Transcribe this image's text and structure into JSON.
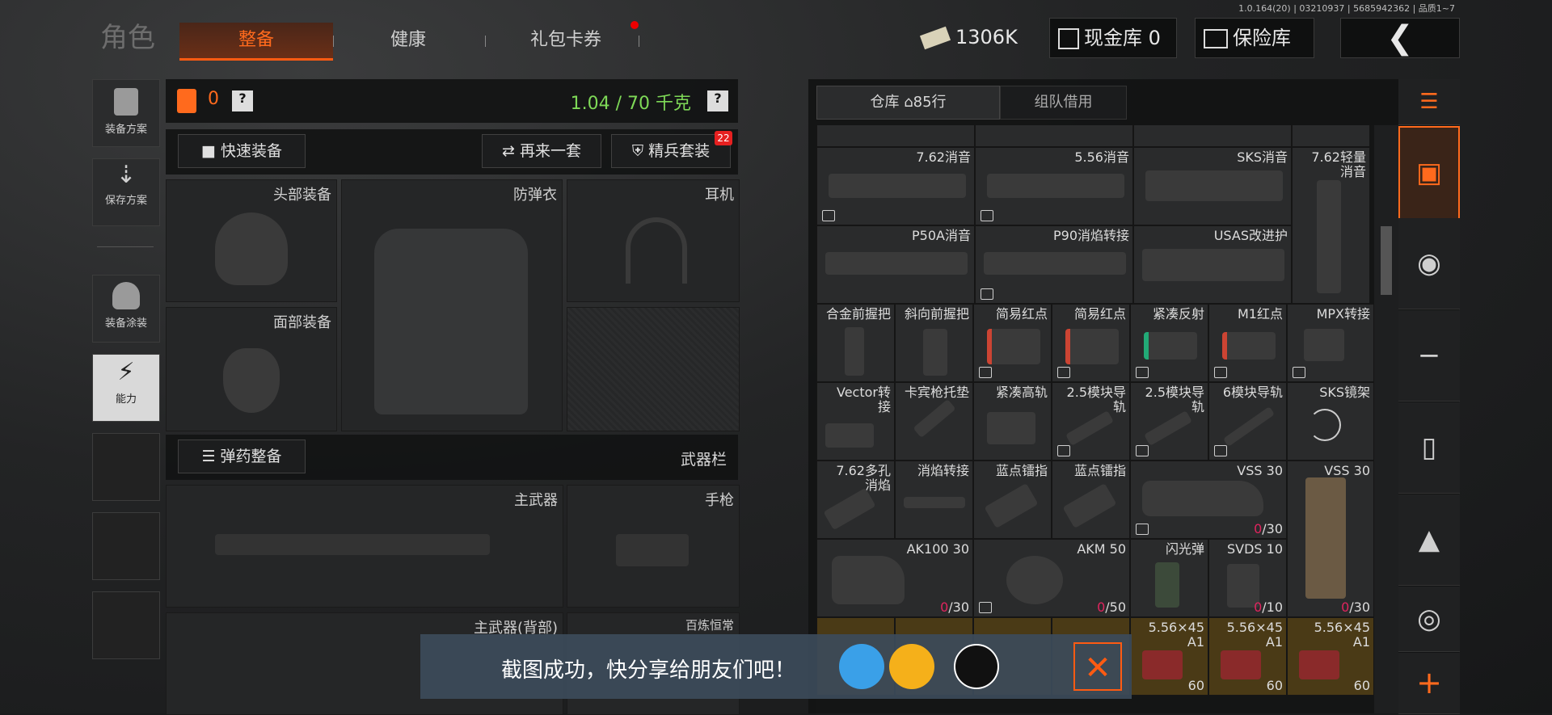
{
  "version": "1.0.164(20) | 03210937 | 5685942362 | 品质1~7",
  "tabs": {
    "role": "角色",
    "equip": "整备",
    "health": "健康",
    "gift": "礼包卡券"
  },
  "top": {
    "money": "1306K",
    "cash": "现金库 0",
    "safe": "保险库"
  },
  "side": {
    "plan": "装备方案",
    "save": "保存方案",
    "paint": "装备涂装",
    "ability": "能力"
  },
  "status": {
    "armor_count": "0",
    "weight": "1.04 / 70 千克"
  },
  "buttons": {
    "quick": "快速装备",
    "again": "再来一套",
    "elite": "精兵套装",
    "elite_badge": "22",
    "ammo": "弹药整备",
    "weapon_bar": "武器栏"
  },
  "slots": {
    "head": "头部装备",
    "vest": "防弹衣",
    "ear": "耳机",
    "face": "面部装备",
    "main": "主武器",
    "pistol": "手枪",
    "main_back": "主武器(背部)",
    "perm": "百炼恒常"
  },
  "storage": {
    "tab": "仓库",
    "rows": "85行",
    "team": "组队借用"
  },
  "items": [
    {
      "name": "7.62消音",
      "count": ""
    },
    {
      "name": "5.56消音",
      "count": ""
    },
    {
      "name": "SKS消音",
      "count": ""
    },
    {
      "name": "7.62轻量消音",
      "count": ""
    },
    {
      "name": "P50A消音",
      "count": ""
    },
    {
      "name": "P90消焰转接",
      "count": ""
    },
    {
      "name": "USAS改进护",
      "count": ""
    },
    {
      "name": "合金前握把",
      "count": ""
    },
    {
      "name": "斜向前握把",
      "count": ""
    },
    {
      "name": "简易红点",
      "count": ""
    },
    {
      "name": "简易红点",
      "count": ""
    },
    {
      "name": "紧凑反射",
      "count": ""
    },
    {
      "name": "M1红点",
      "count": ""
    },
    {
      "name": "MPX转接",
      "count": ""
    },
    {
      "name": "Vector转接",
      "count": ""
    },
    {
      "name": "卡宾枪托垫",
      "count": ""
    },
    {
      "name": "紧凑高轨",
      "count": ""
    },
    {
      "name": "2.5模块导轨",
      "count": ""
    },
    {
      "name": "2.5模块导轨",
      "count": ""
    },
    {
      "name": "6模块导轨",
      "count": ""
    },
    {
      "name": "SKS镜架",
      "count": ""
    },
    {
      "name": "7.62多孔消焰",
      "count": ""
    },
    {
      "name": "消焰转接",
      "count": ""
    },
    {
      "name": "蓝点镭指",
      "count": ""
    },
    {
      "name": "蓝点镭指",
      "count": ""
    },
    {
      "name": "VSS 30",
      "count": "0",
      "max": "/30"
    },
    {
      "name": "VSS 30",
      "count": "0",
      "max": "/30"
    },
    {
      "name": "AK100 30",
      "count": "0",
      "max": "/30"
    },
    {
      "name": "AKM 50",
      "count": "0",
      "max": "/50"
    },
    {
      "name": "闪光弹",
      "count": ""
    },
    {
      "name": "SVDS 10",
      "count": "0",
      "max": "/10"
    },
    {
      "name": "5.56×45 A1",
      "count": "60"
    },
    {
      "name": "5.56×45 A1",
      "count": "60"
    },
    {
      "name": "5.56×45 A1",
      "count": "60"
    }
  ],
  "toast": {
    "text": "截图成功，快分享给朋友们吧！"
  }
}
